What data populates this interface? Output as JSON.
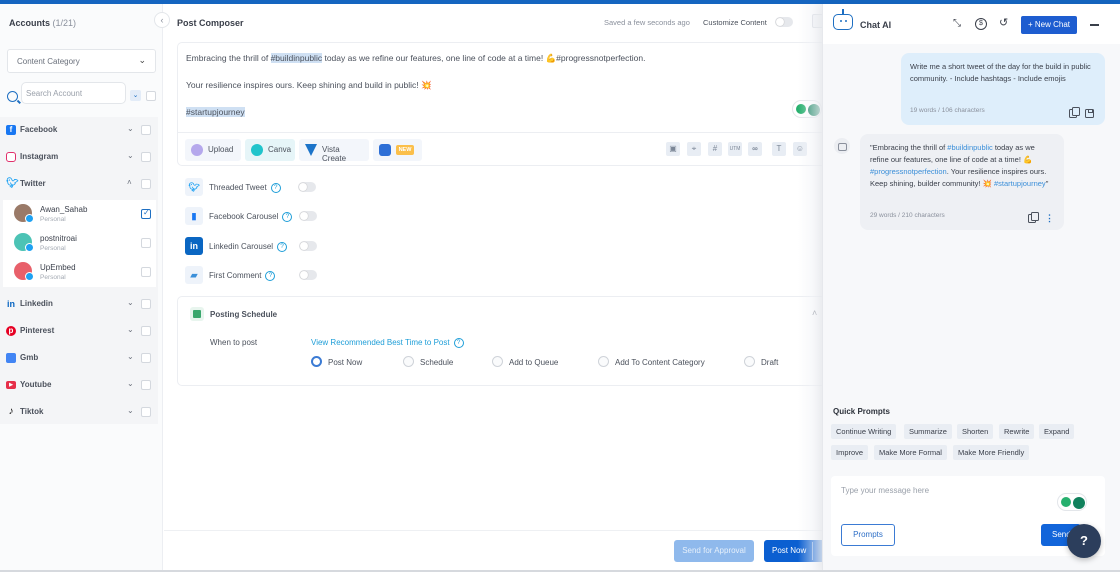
{
  "sidebar": {
    "title": "Accounts",
    "count": "(1/21)",
    "category_select": "Content Category",
    "search_placeholder": "Search Account",
    "platforms": [
      {
        "name": "Facebook",
        "icon": "facebook-icon",
        "color": "#1877f2",
        "expanded": false
      },
      {
        "name": "Instagram",
        "icon": "instagram-icon",
        "color": "#e1306c",
        "expanded": false
      },
      {
        "name": "Twitter",
        "icon": "twitter-icon",
        "color": "#1da1f2",
        "expanded": true
      },
      {
        "name": "Linkedin",
        "icon": "linkedin-icon",
        "color": "#0a66c2",
        "expanded": false
      },
      {
        "name": "Pinterest",
        "icon": "pinterest-icon",
        "color": "#e60023",
        "expanded": false
      },
      {
        "name": "Gmb",
        "icon": "gmb-icon",
        "color": "#4285f4",
        "expanded": false
      },
      {
        "name": "Youtube",
        "icon": "youtube-icon",
        "color": "#ff0000",
        "expanded": false
      },
      {
        "name": "Tiktok",
        "icon": "tiktok-icon",
        "color": "#111111",
        "expanded": false
      }
    ],
    "twitter_accounts": [
      {
        "name": "Awan_Sahab",
        "type": "Personal",
        "checked": true
      },
      {
        "name": "postnitroai",
        "type": "Personal",
        "checked": false
      },
      {
        "name": "UpEmbed",
        "type": "Personal",
        "checked": false
      }
    ]
  },
  "composer": {
    "title": "Post Composer",
    "saved_status": "Saved a few seconds ago",
    "customize_label": "Customize Content",
    "customize_on": false,
    "content": {
      "line1_pre": "Embracing the thrill of ",
      "line1_tag": "#buildinpublic",
      "line1_post": " today as we refine our features, one line of code at a time! 💪#progressnotperfection.",
      "line2": "Your resilience inspires ours. Keep shining and build in public! 💥",
      "line3_tag": "#startupjourney"
    },
    "media_buttons": [
      {
        "label": "Upload",
        "icon": "upload-cloud-icon"
      },
      {
        "label": "Canva",
        "icon": "canva-icon"
      },
      {
        "label": "Vista Create",
        "icon": "vista-create-icon"
      }
    ],
    "ai_badge": "NEW",
    "toolbar_icons": [
      {
        "name": "save-icon",
        "glyph": "▣"
      },
      {
        "name": "location-icon",
        "glyph": "⌖"
      },
      {
        "name": "hashtag-icon",
        "glyph": "#"
      },
      {
        "name": "utm-icon",
        "glyph": "UTM"
      },
      {
        "name": "link-shortener-icon",
        "glyph": "∞"
      },
      {
        "name": "text-format-icon",
        "glyph": "T"
      },
      {
        "name": "emoji-icon",
        "glyph": "☺"
      }
    ],
    "options": [
      {
        "label": "Threaded Tweet",
        "icon": "twitter-icon",
        "enabled": false
      },
      {
        "label": "Facebook Carousel",
        "icon": "facebook-carousel-icon",
        "enabled": false
      },
      {
        "label": "Linkedin Carousel",
        "icon": "linkedin-icon",
        "enabled": false
      },
      {
        "label": "First Comment",
        "icon": "comment-icon",
        "enabled": false
      }
    ],
    "schedule": {
      "title": "Posting Schedule",
      "when_label": "When to post",
      "recommend_link": "View Recommended Best Time to Post",
      "choices": [
        "Post Now",
        "Schedule",
        "Add to Queue",
        "Add To Content Category",
        "Draft"
      ],
      "selected": "Post Now"
    },
    "footer": {
      "approval_label": "Send for Approval",
      "post_label": "Post Now"
    }
  },
  "chat": {
    "title": "Chat AI",
    "new_chat_label": "+ New Chat",
    "user_message": "Write me a short tweet of the day for the build in public community. - Include hashtags - Include emojis",
    "user_meta": "19 words / 106 characters",
    "ai_message": {
      "p1": "\"Embracing the thrill of ",
      "t1": "#buildinpublic",
      "p2": " today as we refine our features, one line of code at a time! 💪 ",
      "t2": "#progressnotperfection",
      "p3": ". Your resilience inspires ours. Keep shining, builder community! 💥 ",
      "t3": "#startupjourney",
      "p4": "\""
    },
    "ai_meta": "29 words / 210 characters",
    "quick_prompts_title": "Quick Prompts",
    "quick_prompts": [
      "Continue Writing",
      "Summarize",
      "Shorten",
      "Rewrite",
      "Expand",
      "Improve",
      "Make More Formal",
      "Make More Friendly"
    ],
    "input_placeholder": "Type your message here",
    "prompts_label": "Prompts",
    "send_label": "Send"
  },
  "help_label": "?",
  "colors": {
    "accent": "#1e5dd0",
    "top_bar": "#1565c0"
  }
}
